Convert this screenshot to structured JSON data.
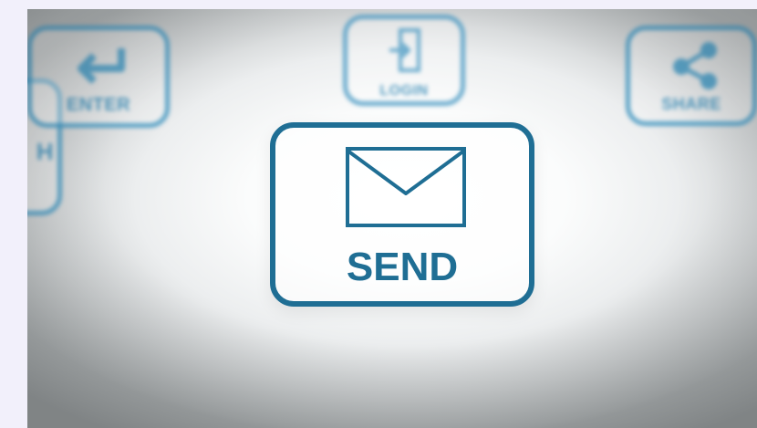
{
  "buttons": {
    "enter": {
      "label": "ENTER",
      "icon": "enter-arrow-icon"
    },
    "login": {
      "label": "LOGIN",
      "icon": "login-door-icon"
    },
    "share": {
      "label": "SHARE",
      "icon": "share-icon"
    },
    "partial": {
      "label": "H"
    },
    "send": {
      "label": "SEND",
      "icon": "envelope-icon"
    }
  },
  "colors": {
    "accent": "#2e86b4",
    "accent_dark": "#1f6e94",
    "page_background": "#f2f0fb"
  }
}
